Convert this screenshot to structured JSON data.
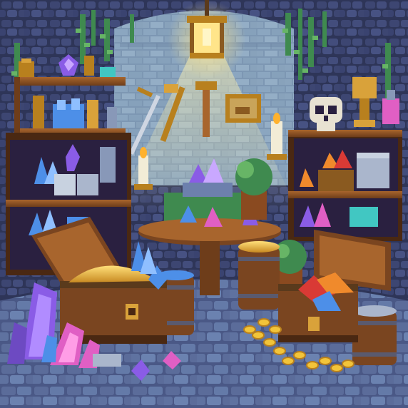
{
  "scene": {
    "title": "",
    "style": "pixel-art",
    "subject": "treasure vault",
    "palette": {
      "background": "#1a1a2e",
      "stone_dark": "#2e3558",
      "stone_mid": "#4a5886",
      "stone_light": "#6d80ad",
      "brick_wall": "#7d97b3",
      "brick_light": "#9bb4c8",
      "wood_dark": "#4a2812",
      "wood_mid": "#7a4520",
      "wood_light": "#a8652d",
      "gold": "#f2c43a",
      "gold_dark": "#b8801e",
      "lamp_glow": "#ffe58a",
      "vine": "#3f8a4f",
      "vine_light": "#67b566",
      "crystal_purple": "#8a5ce6",
      "crystal_blue": "#4d8fe8",
      "crystal_pink": "#e05fc4",
      "crystal_teal": "#41c7c2",
      "gem_red": "#d93a35",
      "gem_orange": "#f08a2c",
      "skull": "#e8e2d2",
      "candle": "#f2ecd6",
      "flame": "#ffb22e"
    },
    "objects": [
      "hanging-lamp-icon",
      "skull-icon",
      "treasure-chest-icon",
      "treasure-chest-icon",
      "gold-pile-icon",
      "crystal-cluster-icon",
      "barrel-icon",
      "round-table-icon",
      "wooden-shelf-icon",
      "key-icon",
      "framed-picture-icon",
      "candle-icon",
      "chalice-icon",
      "sword-icon"
    ]
  }
}
